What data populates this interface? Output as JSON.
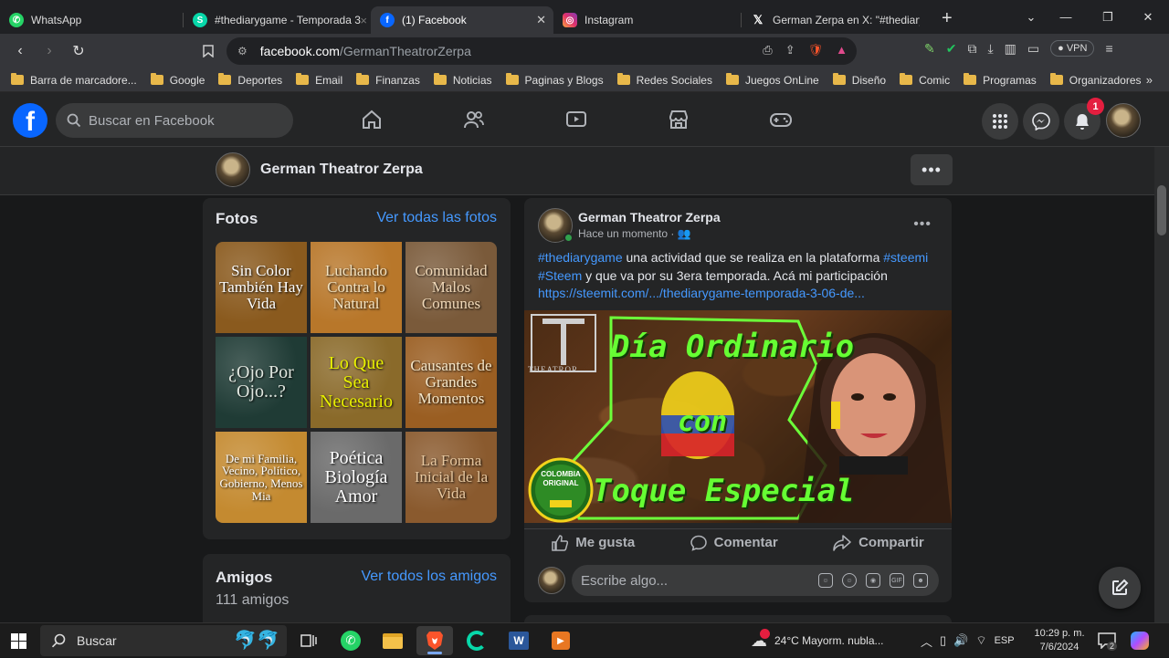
{
  "browser": {
    "tabs": [
      {
        "title": "WhatsApp",
        "favicon": "whatsapp-icon",
        "color": "#25d366"
      },
      {
        "title": "#thediarygame - Temporada 3 - ",
        "favicon": "steemit-icon",
        "color": "#07d7a9"
      },
      {
        "title": "(1) Facebook",
        "favicon": "facebook-icon",
        "color": "#0866ff",
        "active": true
      },
      {
        "title": "Instagram",
        "favicon": "instagram-icon",
        "color": "#e1306c"
      },
      {
        "title": "German Zerpa en X: \"#thediaryg",
        "favicon": "x-icon",
        "color": "#000000"
      }
    ],
    "url_host": "facebook.com",
    "url_path": "/GermanTheatrorZerpa",
    "vpn_label": "VPN",
    "bookmarks": [
      "Barra de marcadore...",
      "Google",
      "Deportes",
      "Email",
      "Finanzas",
      "Noticias",
      "Paginas y Blogs",
      "Redes Sociales",
      "Juegos OnLine",
      "Diseño",
      "Comic",
      "Programas",
      "Organizadores"
    ],
    "bookmarks_more": "»"
  },
  "facebook": {
    "logo": "f",
    "search_placeholder": "Buscar en Facebook",
    "notifications_count": "1",
    "profile_name": "German Theatror Zerpa",
    "more_label": "•••",
    "accent": "#4599ff",
    "photos": {
      "title": "Fotos",
      "link": "Ver todas las fotos",
      "items": [
        {
          "text": "Sin Color También Hay Vida",
          "bg": "#8a5a1e",
          "fg": "#ffffff"
        },
        {
          "text": "Luchando Contra lo Natural",
          "bg": "#b8772a",
          "fg": "#f3e2c0"
        },
        {
          "text": "Comunidad Malos Comunes",
          "bg": "#7a5a3a",
          "fg": "#f0d8b8"
        },
        {
          "text": "¿Ojo Por Ojo...?",
          "bg": "#1f3b35",
          "fg": "#dfe6df"
        },
        {
          "text": "Lo Que Sea Necesario",
          "bg": "#8a6a2a",
          "fg": "#e8f000"
        },
        {
          "text": "Causantes de Grandes Momentos",
          "bg": "#9a5e22",
          "fg": "#f5e6c8"
        },
        {
          "text": "De mi Familia, Vecino, Político, Gobierno, Menos Mia",
          "bg": "#c48a30",
          "fg": "#ffffff"
        },
        {
          "text": "Poética Biología Amor",
          "bg": "#6a6a6a",
          "fg": "#ffffff"
        },
        {
          "text": "La Forma Inicial de la Vida",
          "bg": "#8a5a2e",
          "fg": "#e8c8a0"
        }
      ]
    },
    "friends": {
      "title": "Amigos",
      "link": "Ver todos los amigos",
      "count": "111 amigos"
    },
    "post": {
      "author": "German Theatror Zerpa",
      "time": "Hace un momento",
      "text_hash1": "#thediarygame",
      "text_part1": " una actividad que se realiza en la plataforma ",
      "text_hash2": "#steemi",
      "text_hash3": "#Steem",
      "text_part2": " y que va por su 3era temporada. Acá mi participación",
      "link": "https://steemit.com/.../thediarygame-temporada-3-06-de...",
      "image_title_line1": "Día Ordinario",
      "image_title_line2": "con",
      "image_title_line3": "Toque Especial",
      "image_logo_text": "THEATROR",
      "image_seal_line1": "COLOMBIA",
      "image_seal_line2": "ORIGINAL",
      "like_label": "Me gusta",
      "comment_label": "Comentar",
      "share_label": "Compartir",
      "comment_placeholder": "Escribe algo..."
    }
  },
  "taskbar": {
    "search_label": "Buscar",
    "weather": "24°C  Mayorm. nubla...",
    "lang": "ESP",
    "time": "10:29 p. m.",
    "date": "7/6/2024",
    "notif_count": "2"
  }
}
